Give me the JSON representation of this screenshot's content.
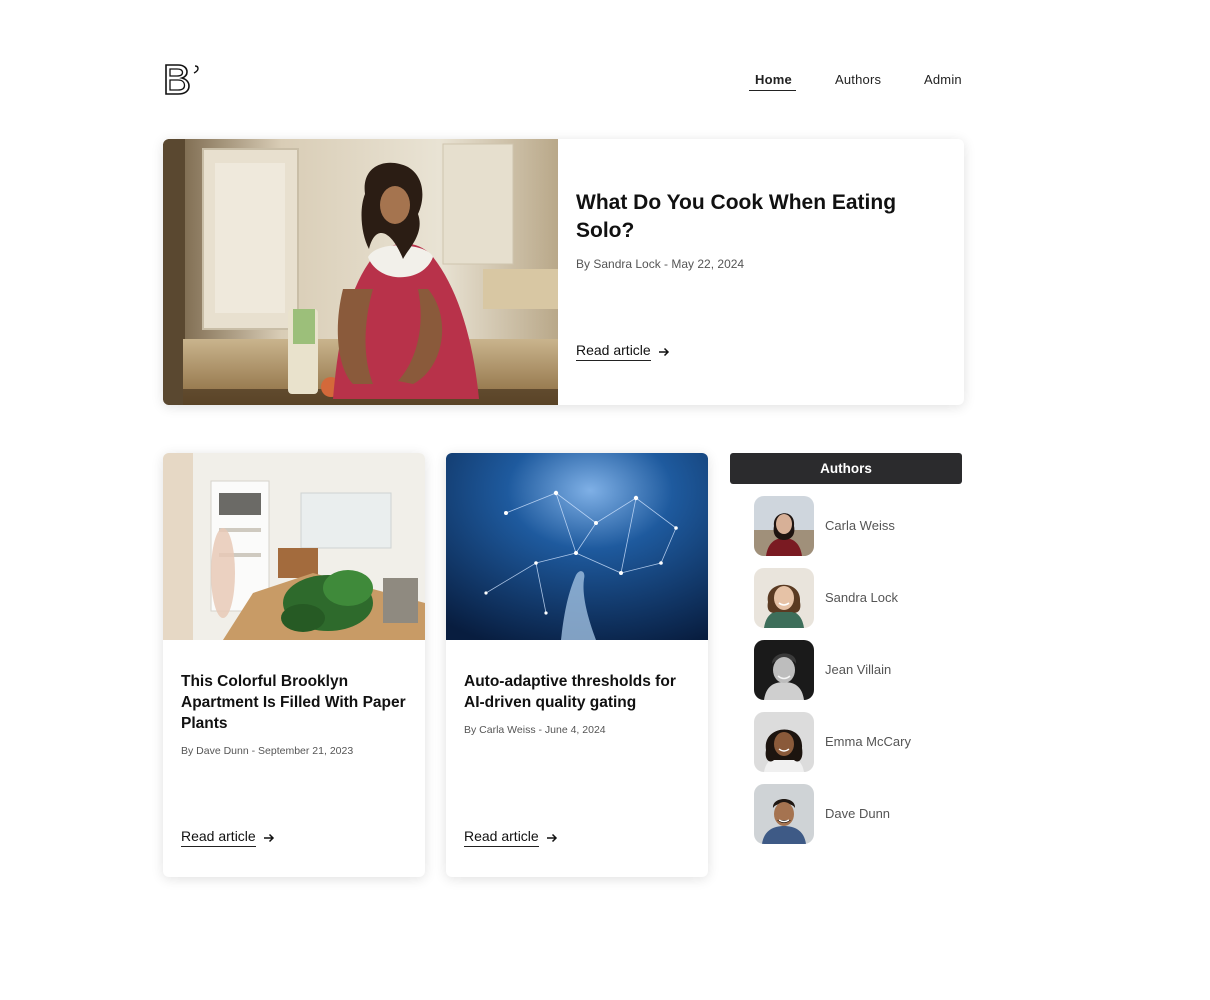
{
  "header": {
    "logo_icon": "brand-logo-b",
    "nav": [
      {
        "label": "Home",
        "active": true
      },
      {
        "label": "Authors",
        "active": false
      },
      {
        "label": "Admin",
        "active": false
      }
    ]
  },
  "hero": {
    "title": "What Do You Cook When Eating Solo?",
    "meta": "By Sandra Lock - May 22, 2024",
    "read_label": "Read article",
    "image": "woman-baking-in-kitchen-photo"
  },
  "cards": [
    {
      "title": "This Colorful Brooklyn Apartment Is Filled With Paper Plants",
      "meta": "By Dave Dunn - September 21, 2023",
      "read_label": "Read article",
      "image": "bright-living-room-with-plants-photo"
    },
    {
      "title": "Auto-adaptive thresholds for AI-driven quality gating",
      "meta": "By Carla Weiss - June 4, 2024",
      "read_label": "Read article",
      "image": "blue-network-nodes-hand-photo"
    }
  ],
  "sidebar": {
    "title": "Authors",
    "authors": [
      {
        "name": "Carla Weiss"
      },
      {
        "name": "Sandra Lock"
      },
      {
        "name": "Jean Villain"
      },
      {
        "name": "Emma McCary"
      },
      {
        "name": "Dave Dunn"
      }
    ]
  },
  "colors": {
    "accent_dark": "#2b2b2d",
    "text": "#111111",
    "muted": "#555555"
  }
}
